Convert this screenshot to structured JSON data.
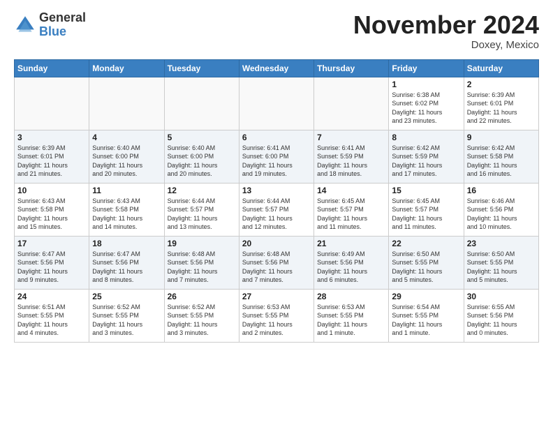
{
  "header": {
    "logo_general": "General",
    "logo_blue": "Blue",
    "month_title": "November 2024",
    "location": "Doxey, Mexico"
  },
  "days_of_week": [
    "Sunday",
    "Monday",
    "Tuesday",
    "Wednesday",
    "Thursday",
    "Friday",
    "Saturday"
  ],
  "weeks": [
    [
      {
        "day": "",
        "info": ""
      },
      {
        "day": "",
        "info": ""
      },
      {
        "day": "",
        "info": ""
      },
      {
        "day": "",
        "info": ""
      },
      {
        "day": "",
        "info": ""
      },
      {
        "day": "1",
        "info": "Sunrise: 6:38 AM\nSunset: 6:02 PM\nDaylight: 11 hours\nand 23 minutes."
      },
      {
        "day": "2",
        "info": "Sunrise: 6:39 AM\nSunset: 6:01 PM\nDaylight: 11 hours\nand 22 minutes."
      }
    ],
    [
      {
        "day": "3",
        "info": "Sunrise: 6:39 AM\nSunset: 6:01 PM\nDaylight: 11 hours\nand 21 minutes."
      },
      {
        "day": "4",
        "info": "Sunrise: 6:40 AM\nSunset: 6:00 PM\nDaylight: 11 hours\nand 20 minutes."
      },
      {
        "day": "5",
        "info": "Sunrise: 6:40 AM\nSunset: 6:00 PM\nDaylight: 11 hours\nand 20 minutes."
      },
      {
        "day": "6",
        "info": "Sunrise: 6:41 AM\nSunset: 6:00 PM\nDaylight: 11 hours\nand 19 minutes."
      },
      {
        "day": "7",
        "info": "Sunrise: 6:41 AM\nSunset: 5:59 PM\nDaylight: 11 hours\nand 18 minutes."
      },
      {
        "day": "8",
        "info": "Sunrise: 6:42 AM\nSunset: 5:59 PM\nDaylight: 11 hours\nand 17 minutes."
      },
      {
        "day": "9",
        "info": "Sunrise: 6:42 AM\nSunset: 5:58 PM\nDaylight: 11 hours\nand 16 minutes."
      }
    ],
    [
      {
        "day": "10",
        "info": "Sunrise: 6:43 AM\nSunset: 5:58 PM\nDaylight: 11 hours\nand 15 minutes."
      },
      {
        "day": "11",
        "info": "Sunrise: 6:43 AM\nSunset: 5:58 PM\nDaylight: 11 hours\nand 14 minutes."
      },
      {
        "day": "12",
        "info": "Sunrise: 6:44 AM\nSunset: 5:57 PM\nDaylight: 11 hours\nand 13 minutes."
      },
      {
        "day": "13",
        "info": "Sunrise: 6:44 AM\nSunset: 5:57 PM\nDaylight: 11 hours\nand 12 minutes."
      },
      {
        "day": "14",
        "info": "Sunrise: 6:45 AM\nSunset: 5:57 PM\nDaylight: 11 hours\nand 11 minutes."
      },
      {
        "day": "15",
        "info": "Sunrise: 6:45 AM\nSunset: 5:57 PM\nDaylight: 11 hours\nand 11 minutes."
      },
      {
        "day": "16",
        "info": "Sunrise: 6:46 AM\nSunset: 5:56 PM\nDaylight: 11 hours\nand 10 minutes."
      }
    ],
    [
      {
        "day": "17",
        "info": "Sunrise: 6:47 AM\nSunset: 5:56 PM\nDaylight: 11 hours\nand 9 minutes."
      },
      {
        "day": "18",
        "info": "Sunrise: 6:47 AM\nSunset: 5:56 PM\nDaylight: 11 hours\nand 8 minutes."
      },
      {
        "day": "19",
        "info": "Sunrise: 6:48 AM\nSunset: 5:56 PM\nDaylight: 11 hours\nand 7 minutes."
      },
      {
        "day": "20",
        "info": "Sunrise: 6:48 AM\nSunset: 5:56 PM\nDaylight: 11 hours\nand 7 minutes."
      },
      {
        "day": "21",
        "info": "Sunrise: 6:49 AM\nSunset: 5:56 PM\nDaylight: 11 hours\nand 6 minutes."
      },
      {
        "day": "22",
        "info": "Sunrise: 6:50 AM\nSunset: 5:55 PM\nDaylight: 11 hours\nand 5 minutes."
      },
      {
        "day": "23",
        "info": "Sunrise: 6:50 AM\nSunset: 5:55 PM\nDaylight: 11 hours\nand 5 minutes."
      }
    ],
    [
      {
        "day": "24",
        "info": "Sunrise: 6:51 AM\nSunset: 5:55 PM\nDaylight: 11 hours\nand 4 minutes."
      },
      {
        "day": "25",
        "info": "Sunrise: 6:52 AM\nSunset: 5:55 PM\nDaylight: 11 hours\nand 3 minutes."
      },
      {
        "day": "26",
        "info": "Sunrise: 6:52 AM\nSunset: 5:55 PM\nDaylight: 11 hours\nand 3 minutes."
      },
      {
        "day": "27",
        "info": "Sunrise: 6:53 AM\nSunset: 5:55 PM\nDaylight: 11 hours\nand 2 minutes."
      },
      {
        "day": "28",
        "info": "Sunrise: 6:53 AM\nSunset: 5:55 PM\nDaylight: 11 hours\nand 1 minute."
      },
      {
        "day": "29",
        "info": "Sunrise: 6:54 AM\nSunset: 5:55 PM\nDaylight: 11 hours\nand 1 minute."
      },
      {
        "day": "30",
        "info": "Sunrise: 6:55 AM\nSunset: 5:56 PM\nDaylight: 11 hours\nand 0 minutes."
      }
    ]
  ]
}
